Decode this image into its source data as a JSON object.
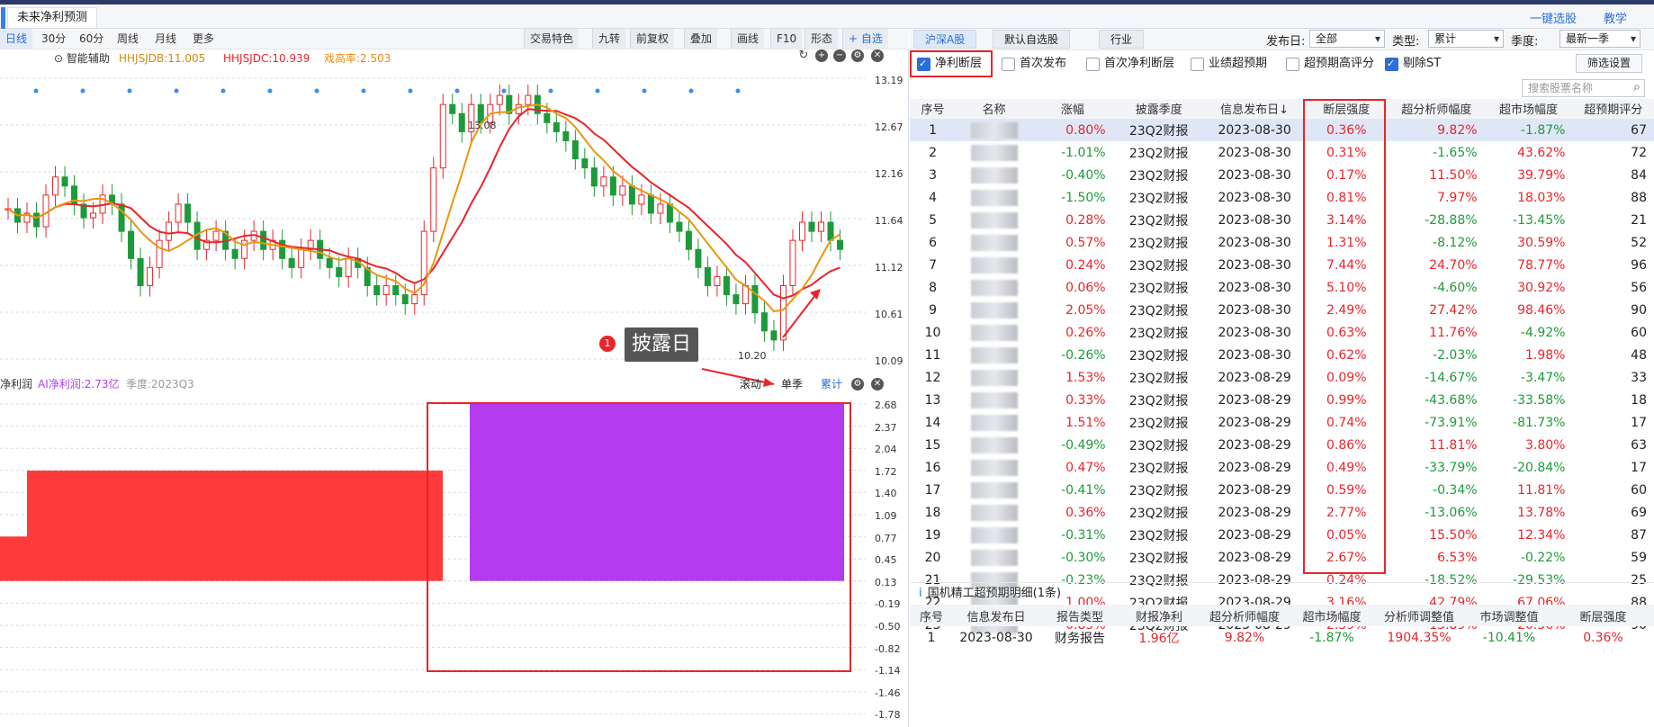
{
  "window": {
    "tab_title": "未来净利预测",
    "link_quick": "一键选股",
    "link_teach": "教学"
  },
  "toolbar": {
    "periods": [
      "日线",
      "30分",
      "60分",
      "周线",
      "月线",
      "更多"
    ],
    "tools": [
      "交易特色",
      "九转",
      "前复权",
      "叠加",
      "画线",
      "F10",
      "形态",
      "+ 自选"
    ]
  },
  "indicators": {
    "assist": "智能辅助",
    "a": "HHJSJDB:11.005",
    "b": "HHJSJDC:10.939",
    "c": "戏高率:2.503"
  },
  "price_axis": [
    "13.19",
    "12.67",
    "12.16",
    "11.64",
    "11.12",
    "10.61",
    "10.09"
  ],
  "price_marks": {
    "high": "13.08",
    "low": "10.20"
  },
  "callout": {
    "num": "1",
    "text": "披露日"
  },
  "lower_panel": {
    "label": "净利润",
    "ai": "AI净利润:2.73亿",
    "season": "季度:2023Q3",
    "toggles": [
      "滚动",
      "单季",
      "累计"
    ],
    "axis": [
      "2.68",
      "2.37",
      "2.04",
      "1.72",
      "1.40",
      "1.09",
      "0.77",
      "0.45",
      "0.13",
      "-0.19",
      "-0.50",
      "-0.82",
      "-1.14",
      "-1.46",
      "-1.78"
    ],
    "colors": {
      "actual": "#ff3a3a",
      "predicted": "#b43bf0"
    }
  },
  "right": {
    "tabs": [
      "沪深A股",
      "默认自选股",
      "行业"
    ],
    "filters": {
      "pub_label": "发布日:",
      "pub_val": "全部",
      "type_label": "类型:",
      "type_val": "累计",
      "season_label": "季度:",
      "season_val": "最新一季"
    },
    "checks": [
      {
        "label": "净利断层",
        "on": true
      },
      {
        "label": "首次发布",
        "on": false
      },
      {
        "label": "首次净利断层",
        "on": false
      },
      {
        "label": "业绩超预期",
        "on": false
      },
      {
        "label": "超预期高评分",
        "on": false
      },
      {
        "label": "剔除ST",
        "on": true
      }
    ],
    "filter_btn": "筛选设置",
    "search_placeholder": "搜索股票名称",
    "columns": [
      "序号",
      "名称",
      "涨幅",
      "披露季度",
      "信息发布日↓",
      "断层强度",
      "超分析师幅度",
      "超市场幅度",
      "超预期评分"
    ],
    "rows": [
      [
        "1",
        "0.80%",
        "23Q2财报",
        "2023-08-30",
        "0.36%",
        "9.82%",
        "-1.87%",
        "67"
      ],
      [
        "2",
        "-1.01%",
        "23Q2财报",
        "2023-08-30",
        "0.31%",
        "-1.65%",
        "43.62%",
        "72"
      ],
      [
        "3",
        "-0.40%",
        "23Q2财报",
        "2023-08-30",
        "0.17%",
        "11.50%",
        "39.79%",
        "84"
      ],
      [
        "4",
        "-1.50%",
        "23Q2财报",
        "2023-08-30",
        "0.81%",
        "7.97%",
        "18.03%",
        "88"
      ],
      [
        "5",
        "0.28%",
        "23Q2财报",
        "2023-08-30",
        "3.14%",
        "-28.88%",
        "-13.45%",
        "21"
      ],
      [
        "6",
        "0.57%",
        "23Q2财报",
        "2023-08-30",
        "1.31%",
        "-8.12%",
        "30.59%",
        "52"
      ],
      [
        "7",
        "0.24%",
        "23Q2财报",
        "2023-08-30",
        "7.44%",
        "24.70%",
        "78.77%",
        "96"
      ],
      [
        "8",
        "0.06%",
        "23Q2财报",
        "2023-08-30",
        "5.10%",
        "-4.60%",
        "30.92%",
        "56"
      ],
      [
        "9",
        "2.05%",
        "23Q2财报",
        "2023-08-30",
        "2.49%",
        "27.42%",
        "98.46%",
        "90"
      ],
      [
        "10",
        "0.26%",
        "23Q2财报",
        "2023-08-30",
        "0.63%",
        "11.76%",
        "-4.92%",
        "60"
      ],
      [
        "11",
        "-0.26%",
        "23Q2财报",
        "2023-08-30",
        "0.62%",
        "-2.03%",
        "1.98%",
        "48"
      ],
      [
        "12",
        "1.53%",
        "23Q2财报",
        "2023-08-29",
        "0.09%",
        "-14.67%",
        "-3.47%",
        "33"
      ],
      [
        "13",
        "0.33%",
        "23Q2财报",
        "2023-08-29",
        "0.99%",
        "-43.68%",
        "-33.58%",
        "18"
      ],
      [
        "14",
        "1.51%",
        "23Q2财报",
        "2023-08-29",
        "0.74%",
        "-73.91%",
        "-81.73%",
        "17"
      ],
      [
        "15",
        "-0.49%",
        "23Q2财报",
        "2023-08-29",
        "0.86%",
        "11.81%",
        "3.80%",
        "63"
      ],
      [
        "16",
        "0.47%",
        "23Q2财报",
        "2023-08-29",
        "0.49%",
        "-33.79%",
        "-20.84%",
        "17"
      ],
      [
        "17",
        "-0.41%",
        "23Q2财报",
        "2023-08-29",
        "0.59%",
        "-0.34%",
        "11.81%",
        "60"
      ],
      [
        "18",
        "0.36%",
        "23Q2财报",
        "2023-08-29",
        "2.77%",
        "-13.06%",
        "13.78%",
        "69"
      ],
      [
        "19",
        "-0.31%",
        "23Q2财报",
        "2023-08-29",
        "0.05%",
        "15.50%",
        "12.34%",
        "87"
      ],
      [
        "20",
        "-0.30%",
        "23Q2财报",
        "2023-08-29",
        "2.67%",
        "6.53%",
        "-0.22%",
        "59"
      ],
      [
        "21",
        "-0.23%",
        "23Q2财报",
        "2023-08-29",
        "0.24%",
        "-18.52%",
        "-29.53%",
        "25"
      ],
      [
        "22",
        "1.00%",
        "23Q2财报",
        "2023-08-29",
        "3.16%",
        "42.79%",
        "67.06%",
        "88"
      ],
      [
        "23",
        "0.85%",
        "23Q2财报",
        "2023-08-29",
        "2.59%",
        "13.89%",
        "20.56%",
        "90"
      ]
    ],
    "detail": {
      "title": "国机精工超预期明细(1条)",
      "columns": [
        "序号",
        "信息发布日",
        "报告类型",
        "财报净利",
        "超分析师幅度",
        "超市场幅度",
        "分析师调整值",
        "市场调整值",
        "断层强度"
      ],
      "row": [
        "1",
        "2023-08-30",
        "财务报告",
        "1.96亿",
        "9.82%",
        "-1.87%",
        "1904.35%",
        "-10.41%",
        "0.36%"
      ]
    }
  }
}
